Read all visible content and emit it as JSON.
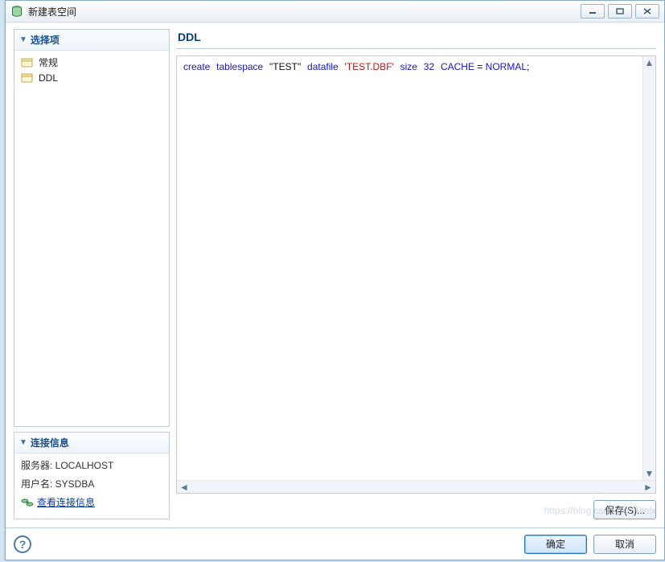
{
  "window": {
    "title": "新建表空间"
  },
  "sidebar": {
    "options_header": "选择项",
    "items": [
      {
        "label": "常规"
      },
      {
        "label": "DDL"
      }
    ],
    "connection_header": "连接信息",
    "server_label": "服务器: LOCALHOST",
    "user_label": "用户名: SYSDBA",
    "view_connection_label": "查看连接信息"
  },
  "main": {
    "title": "DDL",
    "ddl": {
      "kw_create": "create",
      "kw_tablespace": "tablespace",
      "ident_name": "\"TEST\"",
      "kw_datafile": "datafile",
      "str_file": "'TEST.DBF'",
      "kw_size": "size",
      "num_size": "32",
      "kw_cache": "CACHE",
      "eq": " = ",
      "kw_normal": "NORMAL",
      "semi": ";"
    },
    "save_label": "保存(S)..."
  },
  "footer": {
    "ok_label": "确定",
    "cancel_label": "取消"
  },
  "watermark": "https://blog.csdn.net/Alinlx"
}
